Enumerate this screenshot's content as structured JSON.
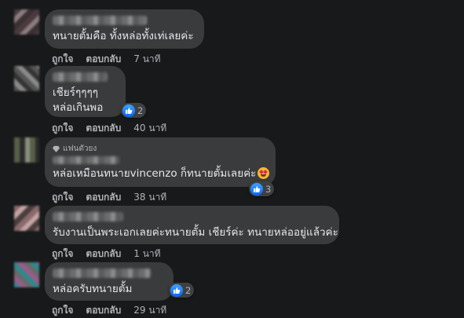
{
  "comments": [
    {
      "text": "ทนายตั้มคือ ทั้งหล่อทั้งเท่เลยค่ะ",
      "actions": {
        "like": "ถูกใจ",
        "reply": "ตอบกลับ",
        "time": "7 นาที"
      }
    },
    {
      "lines": [
        "เชียร์ๆๆๆๆ",
        "หล่อเกินพอ"
      ],
      "reaction_count": "2",
      "actions": {
        "like": "ถูกใจ",
        "reply": "ตอบกลับ",
        "time": "40 นาที"
      }
    },
    {
      "badge": "แฟนตัวยง",
      "text": "หล่อเหมือนทนายvincenzo ก็ทนายตั้มเลยค่ะ",
      "reaction_count": "3",
      "actions": {
        "like": "ถูกใจ",
        "reply": "ตอบกลับ",
        "time": "38 นาที"
      }
    },
    {
      "text": "รับงานเป็นพระเอกเลยค่ะทนายตั้ม เชียร์ค่ะ ทนายหล่ออยู่แล้วค่ะ",
      "actions": {
        "like": "ถูกใจ",
        "reply": "ตอบกลับ",
        "time": "1 นาที"
      }
    },
    {
      "text": "หล่อครับทนายตั้ม",
      "reaction_count": "2",
      "actions": {
        "like": "ถูกใจ",
        "reply": "ตอบกลับ",
        "time": "29 นาที"
      }
    }
  ],
  "colors": {
    "background": "#18191a",
    "bubble": "#3a3b3c",
    "like_blue": "#0866ff",
    "muted_text": "#b0b3b8"
  },
  "icons": {
    "reaction": "like-thumb-icon",
    "emoji": "star-struck-emoji-icon",
    "badge": "diamond-icon"
  }
}
